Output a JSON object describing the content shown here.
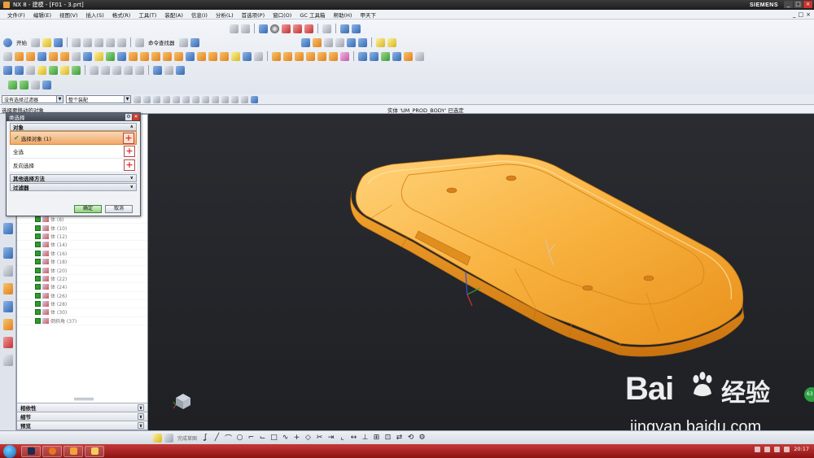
{
  "window": {
    "title": "NX 8 - 建模 - [F01 - 3.prt]",
    "brand": "SIEMENS",
    "controls": [
      "_",
      "□",
      "×"
    ]
  },
  "menu": {
    "items": [
      "文件(F)",
      "编辑(E)",
      "视图(V)",
      "插入(S)",
      "格式(R)",
      "工具(T)",
      "装配(A)",
      "信息(I)",
      "分析(L)",
      "首选项(P)",
      "窗口(O)",
      "GC 工具箱",
      "帮助(H)",
      "甲天下"
    ],
    "mdi_controls": [
      "_",
      "□",
      "×"
    ]
  },
  "toolbar": {
    "start_label": "开始",
    "command_finder_label": "命令查找器"
  },
  "filterbar": {
    "type_filter": "没有选择过滤器",
    "scope": "整个装配"
  },
  "infoline": {
    "prompt": "选择要移动的对象",
    "status": "实体 'UM_PROD_BODY' 已选定"
  },
  "navigator": {
    "rows": [
      {
        "label": "体 (8)"
      },
      {
        "label": "体 (10)"
      },
      {
        "label": "体 (12)"
      },
      {
        "label": "体 (14)"
      },
      {
        "label": "体 (16)"
      },
      {
        "label": "体 (18)"
      },
      {
        "label": "体 (20)"
      },
      {
        "label": "体 (22)"
      },
      {
        "label": "体 (24)"
      },
      {
        "label": "体 (26)"
      },
      {
        "label": "体 (28)"
      },
      {
        "label": "体 (30)"
      },
      {
        "label": "倒斜角 (37)"
      }
    ],
    "sections": [
      "相依性",
      "细节",
      "预览"
    ]
  },
  "dialog": {
    "title": "类选择",
    "objects_header": "对象",
    "select_objects": "选择对象 (1)",
    "select_all": "全选",
    "invert_selection": "反向选择",
    "other_methods": "其他选择方法",
    "filter": "过滤器",
    "ok": "确定",
    "cancel": "取消"
  },
  "viewport": {
    "part_color": "#f5a623",
    "background": "#25272b"
  },
  "bottombar": {
    "sketch_label": "完成草图"
  },
  "watermark": {
    "brand": "Bai",
    "brand_cn": "经验",
    "url": "jingyan.baidu.com"
  },
  "badge": {
    "text": "63"
  },
  "taskbar": {
    "clock": "20:17"
  }
}
